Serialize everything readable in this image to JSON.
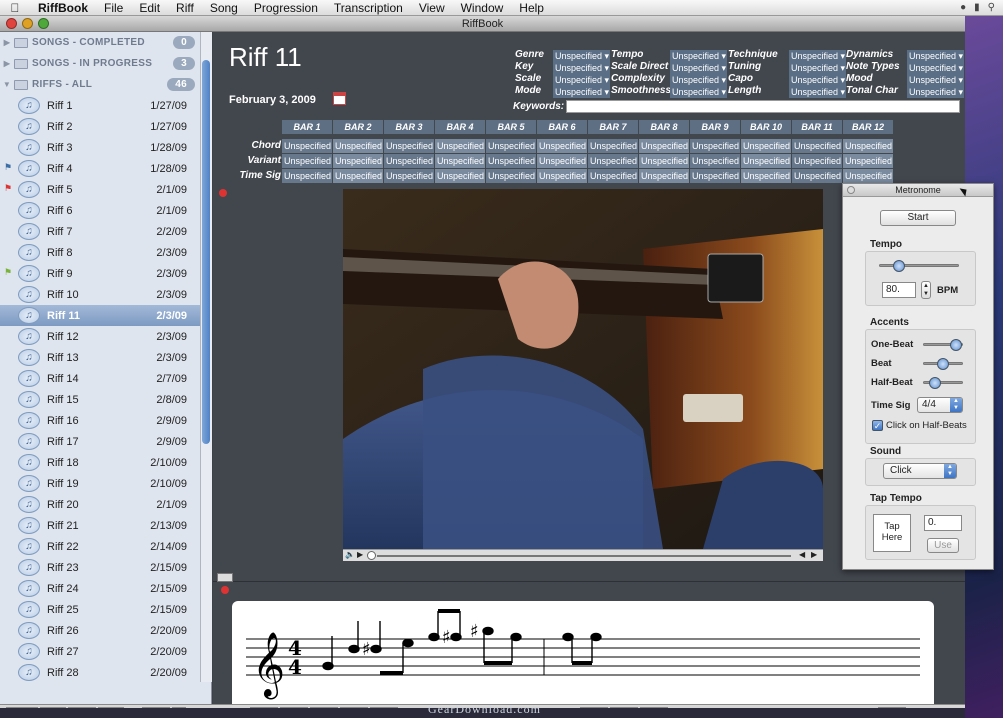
{
  "menubar": {
    "app": "RiffBook",
    "items": [
      "File",
      "Edit",
      "Riff",
      "Song",
      "Progression",
      "Transcription",
      "View",
      "Window",
      "Help"
    ]
  },
  "window": {
    "title": "RiffBook"
  },
  "sidebar": {
    "groups": [
      {
        "label": "SONGS - COMPLETED",
        "count": "0"
      },
      {
        "label": "SONGS - IN PROGRESS",
        "count": "3"
      },
      {
        "label": "RIFFS - ALL",
        "count": "46"
      }
    ],
    "riffs": [
      {
        "name": "Riff 1",
        "date": "1/27/09"
      },
      {
        "name": "Riff 2",
        "date": "1/27/09"
      },
      {
        "name": "Riff 3",
        "date": "1/28/09"
      },
      {
        "name": "Riff 4",
        "date": "1/28/09",
        "flag": "#3a6ea5"
      },
      {
        "name": "Riff 5",
        "date": "2/1/09",
        "flag": "#d33"
      },
      {
        "name": "Riff 6",
        "date": "2/1/09"
      },
      {
        "name": "Riff 7",
        "date": "2/2/09"
      },
      {
        "name": "Riff 8",
        "date": "2/3/09"
      },
      {
        "name": "Riff 9",
        "date": "2/3/09",
        "flag": "#7ab33a"
      },
      {
        "name": "Riff 10",
        "date": "2/3/09"
      },
      {
        "name": "Riff 11",
        "date": "2/3/09",
        "selected": true
      },
      {
        "name": "Riff 12",
        "date": "2/3/09"
      },
      {
        "name": "Riff 13",
        "date": "2/3/09"
      },
      {
        "name": "Riff 14",
        "date": "2/7/09"
      },
      {
        "name": "Riff 15",
        "date": "2/8/09"
      },
      {
        "name": "Riff 16",
        "date": "2/9/09"
      },
      {
        "name": "Riff 17",
        "date": "2/9/09"
      },
      {
        "name": "Riff 18",
        "date": "2/10/09"
      },
      {
        "name": "Riff 19",
        "date": "2/10/09"
      },
      {
        "name": "Riff 20",
        "date": "2/1/09"
      },
      {
        "name": "Riff 21",
        "date": "2/13/09"
      },
      {
        "name": "Riff 22",
        "date": "2/14/09"
      },
      {
        "name": "Riff 23",
        "date": "2/15/09"
      },
      {
        "name": "Riff 24",
        "date": "2/15/09"
      },
      {
        "name": "Riff 25",
        "date": "2/15/09"
      },
      {
        "name": "Riff 26",
        "date": "2/20/09"
      },
      {
        "name": "Riff 27",
        "date": "2/20/09"
      },
      {
        "name": "Riff 28",
        "date": "2/20/09"
      }
    ]
  },
  "detail": {
    "title": "Riff 11",
    "date": "February 3, 2009",
    "meta_columns": [
      [
        "Genre",
        "Key",
        "Scale",
        "Mode"
      ],
      [
        "Tempo",
        "Scale Direct",
        "Complexity",
        "Smoothness"
      ],
      [
        "Technique",
        "Tuning",
        "Capo",
        "Length"
      ],
      [
        "Dynamics",
        "Note Types",
        "Mood",
        "Tonal Char"
      ]
    ],
    "unspecified": "Unspecified",
    "keywords_label": "Keywords:",
    "bars": [
      "BAR 1",
      "BAR 2",
      "BAR 3",
      "BAR 4",
      "BAR 5",
      "BAR 6",
      "BAR 7",
      "BAR 8",
      "BAR 9",
      "BAR 10",
      "BAR 11",
      "BAR 12"
    ],
    "bar_rows": [
      "Chord",
      "Variant",
      "Time Sig"
    ]
  },
  "metronome": {
    "title": "Metronome",
    "start": "Start",
    "tempo_label": "Tempo",
    "tempo_value": "80.",
    "bpm": "BPM",
    "accents_label": "Accents",
    "one_beat": "One-Beat",
    "beat": "Beat",
    "half_beat": "Half-Beat",
    "time_sig_label": "Time Sig",
    "time_sig_value": "4/4",
    "half_beats_check": "Click on Half-Beats",
    "sound_label": "Sound",
    "sound_value": "Click",
    "tap_label": "Tap Tempo",
    "tap_here": "Tap Here",
    "tap_value": "0.",
    "use": "Use"
  },
  "notation": {
    "time_sig_top": "4",
    "time_sig_bottom": "4"
  },
  "watermark": "GearDownload.com",
  "icons": [
    "apple-icon",
    "folder-icon",
    "music-note-icon",
    "flag-icon",
    "calendar-icon",
    "play-icon",
    "volume-icon",
    "treble-clef-icon",
    "plus-icon",
    "minus-icon",
    "gear-icon",
    "search-icon",
    "mic-icon",
    "camera-icon"
  ]
}
